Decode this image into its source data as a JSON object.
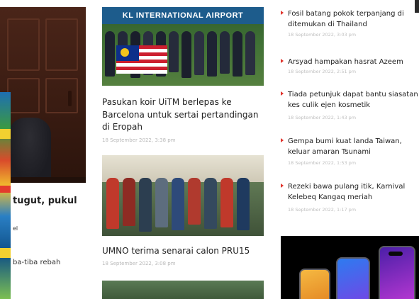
{
  "left_column": {
    "headline_fragment": "tugut, pukul",
    "meta_fragment": "el",
    "snippet_fragment": "ba-tiba rebah"
  },
  "middle_column": {
    "photo_1_sign": "KL INTERNATIONAL AIRPORT",
    "articles": [
      {
        "title": "Pasukan koir UiTM berlepas ke Barcelona untuk sertai pertandingan di Eropah",
        "meta": "18 September 2022, 3:38 pm"
      },
      {
        "title": "UMNO terima senarai calon PRU15",
        "meta": "18 September 2022, 3:08 pm"
      }
    ]
  },
  "right_column": {
    "list": [
      {
        "title": "Fosil batang pokok terpanjang di ditemukan di Thailand",
        "meta": "18 September 2022, 3:03 pm"
      },
      {
        "title": "Arsyad hampakan hasrat Azeem",
        "meta": "18 September 2022, 2:51 pm"
      },
      {
        "title": "Tiada petunjuk dapat bantu siasatan kes culik ejen kosmetik",
        "meta": "18 September 2022, 1:43 pm"
      },
      {
        "title": "Gempa bumi kuat landa Taiwan, keluar amaran Tsunami",
        "meta": "18 September 2022, 1:53 pm"
      },
      {
        "title": "Rezeki bawa pulang itik, Karnival Kelebeq Kangaq meriah",
        "meta": "18 September 2022, 1:17 pm"
      }
    ]
  },
  "colors": {
    "bullet": "#e0332b",
    "headline_text": "#222222",
    "meta_text": "#b8b8b8",
    "ad_background": "#000000"
  }
}
